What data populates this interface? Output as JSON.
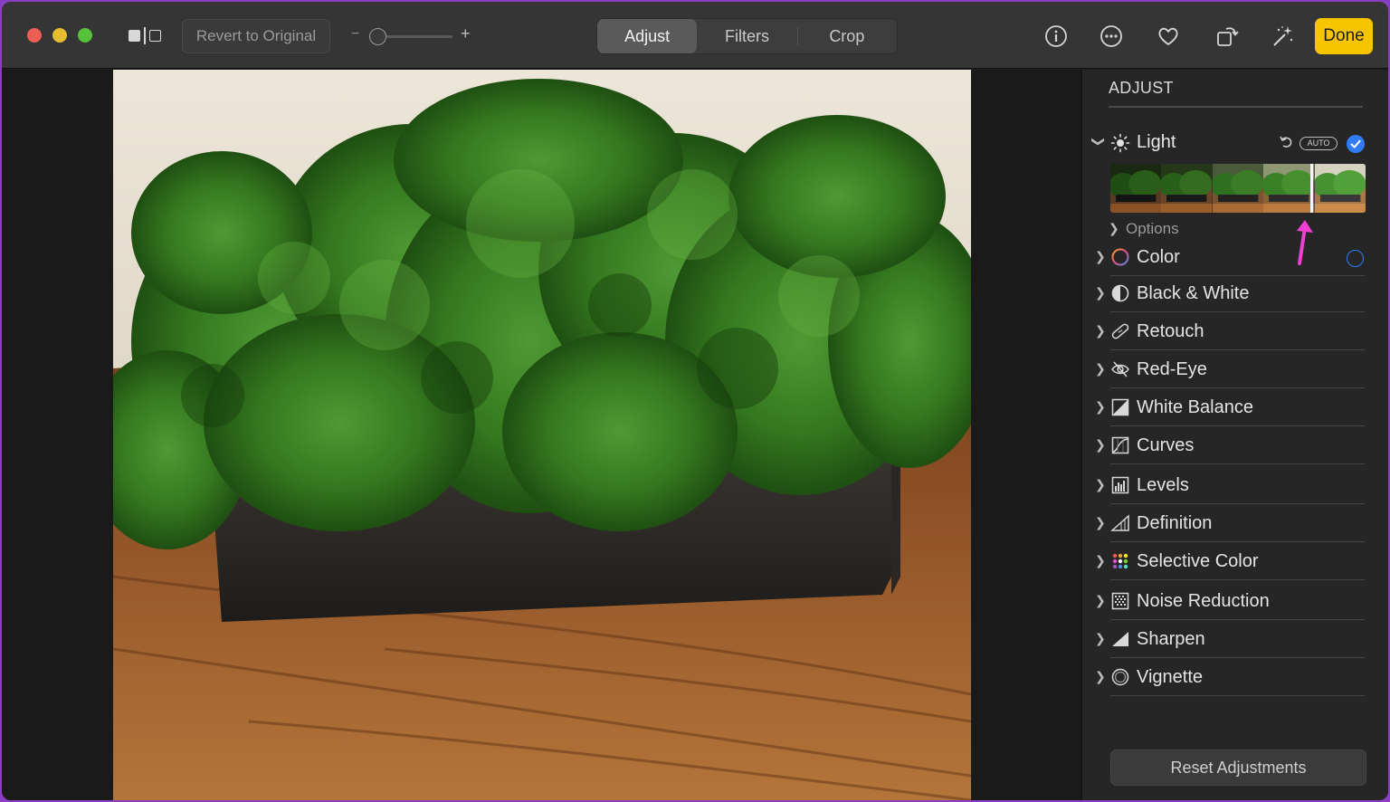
{
  "toolbar": {
    "revert_label": "Revert to Original",
    "zoom_minus": "−",
    "zoom_plus": "+",
    "zoom_level": 0.0,
    "tabs": [
      {
        "label": "Adjust",
        "active": true
      },
      {
        "label": "Filters",
        "active": false
      },
      {
        "label": "Crop",
        "active": false
      }
    ],
    "icons": [
      "info-icon",
      "more-icon",
      "favorite-heart-icon",
      "rotate-icon",
      "auto-enhance-magic-wand-icon"
    ],
    "done_label": "Done",
    "accent_color": "#f7c500"
  },
  "sidebar": {
    "title": "ADJUST",
    "light": {
      "label": "Light",
      "auto_label": "AUTO",
      "enabled": true,
      "options_label": "Options",
      "slider_position": 0.9
    },
    "items": [
      {
        "label": "Color",
        "icon": "color-circle-icon",
        "enabled": false
      },
      {
        "label": "Black & White",
        "icon": "half-circle-icon"
      },
      {
        "label": "Retouch",
        "icon": "bandage-icon"
      },
      {
        "label": "Red-Eye",
        "icon": "eye-slash-icon"
      },
      {
        "label": "White Balance",
        "icon": "white-balance-icon"
      },
      {
        "label": "Curves",
        "icon": "curves-icon"
      },
      {
        "label": "Levels",
        "icon": "levels-icon"
      },
      {
        "label": "Definition",
        "icon": "definition-triangle-icon"
      },
      {
        "label": "Selective Color",
        "icon": "selective-color-dots-icon"
      },
      {
        "label": "Noise Reduction",
        "icon": "noise-reduction-icon"
      },
      {
        "label": "Sharpen",
        "icon": "sharpen-icon"
      },
      {
        "label": "Vignette",
        "icon": "vignette-icon"
      }
    ],
    "reset_label": "Reset Adjustments"
  },
  "colors": {
    "active_blue": "#2f7cf6",
    "annotation_pink": "#f03fd2"
  }
}
